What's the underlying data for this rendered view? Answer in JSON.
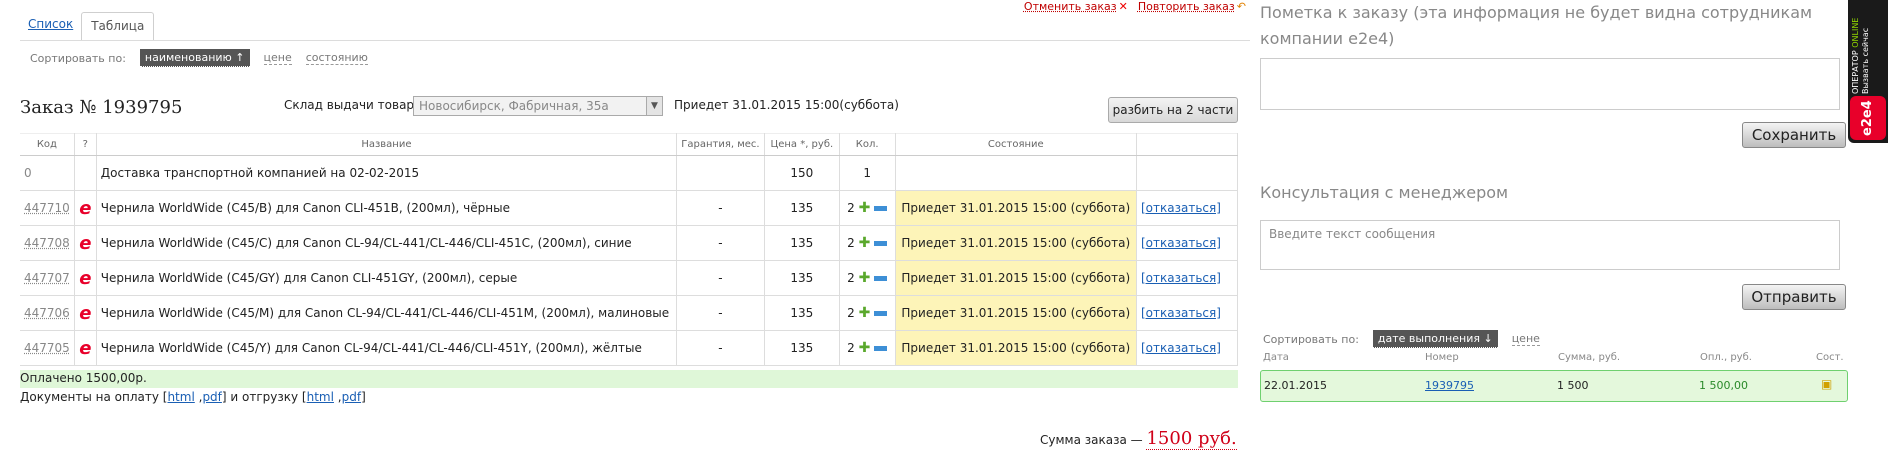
{
  "tabs": {
    "list": "Список",
    "table": "Таблица"
  },
  "top_actions": {
    "cancel": "Отменить заказ",
    "repeat": "Повторить заказ"
  },
  "sort": {
    "label": "Сортировать по:",
    "active": "наименованию ↑",
    "price": "цене",
    "state": "состоянию"
  },
  "order": {
    "prefix": "Заказ №",
    "number": "1939795",
    "warehouse_label": "Склад выдачи товара:",
    "warehouse_value": "Новосибирск, Фабричная, 35а",
    "arrival": "Приедет 31.01.2015 15:00(суббота)",
    "split_button": "разбить на 2 части"
  },
  "table": {
    "headers": [
      "Код",
      "?",
      "Название",
      "Гарантия, мес.",
      "Цена *, руб.",
      "Кол.",
      "Состояние",
      ""
    ],
    "delivery": {
      "code": "0",
      "name": "Доставка транспортной компанией на 02-02-2015",
      "price": "150",
      "qty": "1"
    },
    "rows": [
      {
        "code": "447710",
        "name": "Чернила WorldWide (C45/B) для Canon CLI-451B, (200мл), чёрные",
        "warranty": "-",
        "price": "135",
        "qty": "2",
        "state": "Приедет  31.01.2015 15:00 (суббота)",
        "action": "[отказаться]"
      },
      {
        "code": "447708",
        "name": "Чернила WorldWide (C45/C) для Canon CL-94/CL-441/CL-446/CLI-451C, (200мл), синие",
        "warranty": "-",
        "price": "135",
        "qty": "2",
        "state": "Приедет  31.01.2015 15:00 (суббота)",
        "action": "[отказаться]"
      },
      {
        "code": "447707",
        "name": "Чернила WorldWide (C45/GY) для Canon CLI-451GY, (200мл), серые",
        "warranty": "-",
        "price": "135",
        "qty": "2",
        "state": "Приедет  31.01.2015 15:00 (суббота)",
        "action": "[отказаться]"
      },
      {
        "code": "447706",
        "name": "Чернила WorldWide (C45/M) для Canon CL-94/CL-441/CL-446/CLI-451M, (200мл), малиновые",
        "warranty": "-",
        "price": "135",
        "qty": "2",
        "state": "Приедет  31.01.2015 15:00 (суббота)",
        "action": "[отказаться]"
      },
      {
        "code": "447705",
        "name": "Чернила WorldWide (C45/Y) для Canon CL-94/CL-441/CL-446/CLI-451Y, (200мл), жёлтые",
        "warranty": "-",
        "price": "135",
        "qty": "2",
        "state": "Приедет  31.01.2015 15:00 (суббота)",
        "action": "[отказаться]"
      }
    ]
  },
  "paid": "Оплачено 1500,00р.",
  "docs": {
    "payment": "Документы на оплату",
    "shipment": "и отгрузку",
    "html": "html",
    "pdf": "pdf"
  },
  "total": {
    "label": "Сумма заказа —",
    "value": "1500 руб."
  },
  "note": {
    "title": "Пометка к заказу (эта информация не будет видна сотрудникам компании e2e4)",
    "value": "",
    "save": "Сохранить"
  },
  "consult": {
    "title": "Консультация с менеджером",
    "placeholder": "Введите текст сообщения",
    "send": "Отправить"
  },
  "history": {
    "sort_label": "Сортировать по:",
    "sort_active": "дате выполнения ↓",
    "sort_price": "цене",
    "headers": {
      "date": "Дата",
      "number": "Номер",
      "sum": "Сумма, руб.",
      "paid": "Опл., руб.",
      "state": "Сост."
    },
    "row": {
      "date": "22.01.2015",
      "number": "1939795",
      "sum": "1 500",
      "paid": "1 500,00"
    }
  },
  "operator": {
    "line1": "ОПЕРАТОР",
    "online": "ONLINE",
    "line2": "Вызвать сейчас",
    "brand": "e2e4"
  },
  "colors": {
    "accent_red": "#d00018",
    "status_yellow": "#fdf4b8",
    "paid_green": "#dff7d8",
    "link_blue": "#1a5fb4"
  }
}
